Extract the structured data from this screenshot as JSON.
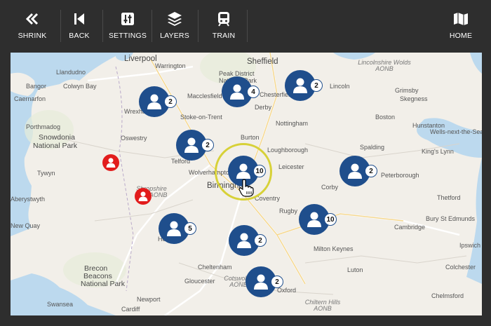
{
  "toolbar": {
    "shrink_label": "SHRINK",
    "back_label": "BACK",
    "settings_label": "SETTINGS",
    "layers_label": "LAYERS",
    "train_label": "TRAIN",
    "home_label": "HOME"
  },
  "map": {
    "places": {
      "liverpool": "Liverpool",
      "warrington": "Warrington",
      "sheffield": "Sheffield",
      "peak_district": "Peak District",
      "national_park": "National Park",
      "lincolnshire_wolds": "Lincolnshire Wolds AONB",
      "llandudno": "Llandudno",
      "bangor": "Bangor",
      "colwyn_bay": "Colwyn Bay",
      "caernarfon": "Caernarfon",
      "macclesfield": "Macclesfield",
      "chesterfield": "Chesterfield",
      "lincoln": "Lincoln",
      "grimsby": "Grimsby",
      "skegness": "Skegness",
      "wrexham": "Wrexham",
      "stoke": "Stoke-on-Trent",
      "derby": "Derby",
      "nottingham": "Nottingham",
      "boston": "Boston",
      "hunstanton": "Hunstanton",
      "wells": "Wells-next-the-Sea",
      "porthmadog": "Porthmadog",
      "snowdonia": "Snowdonia",
      "snowdonia_np": "National Park",
      "oswestry": "Oswestry",
      "burton": "Burton",
      "loughborough": "Loughborough",
      "spalding": "Spalding",
      "kings_lynn": "King's Lynn",
      "telford": "Telford",
      "wolverhampton": "Wolverhampton",
      "leicester": "Leicester",
      "tywyn": "Tywyn",
      "birmingham": "Birmingham",
      "shropshire_aonb": "Shropshire Hills AONB",
      "aberystwyth": "Aberystwyth",
      "corby": "Corby",
      "coventry": "Coventry",
      "peterborough": "Peterborough",
      "thetford": "Thetford",
      "new_quay": "New Quay",
      "hereford": "Hereford",
      "rugby": "Rugby",
      "cambridge": "Cambridge",
      "bury": "Bury St Edmunds",
      "ipswich": "Ipswich",
      "milton_keynes": "Milton Keynes",
      "brecon": "Brecon",
      "beacons": "Beacons",
      "beacons_np": "National Park",
      "cheltenham": "Cheltenham",
      "gloucester": "Gloucester",
      "luton": "Luton",
      "colchester": "Colchester",
      "cotswolds": "Cotswolds AONB",
      "swansea": "Swansea",
      "cardiff": "Cardiff",
      "chiltern": "Chiltern Hills AONB",
      "newport": "Newport",
      "chelmsford": "Chelmsford",
      "oxford": "Oxford"
    },
    "clusters": [
      {
        "count": "2"
      },
      {
        "count": "4"
      },
      {
        "count": "2"
      },
      {
        "count": "2"
      },
      {
        "count": "10"
      },
      {
        "count": "2"
      },
      {
        "count": "5"
      },
      {
        "count": "10"
      },
      {
        "count": "2"
      },
      {
        "count": "2"
      }
    ]
  },
  "colors": {
    "cluster": "#1f4e8c",
    "marker": "#e21c1c",
    "highlight": "#d7d138",
    "toolbar": "#2e2e2e"
  },
  "icons": {
    "shrink": "double-chevron-left-icon",
    "back": "skip-back-icon",
    "settings": "sliders-icon",
    "layers": "layers-icon",
    "train": "train-icon",
    "home": "map-icon",
    "cluster": "person-icon",
    "cursor": "hand-pointer-icon"
  }
}
